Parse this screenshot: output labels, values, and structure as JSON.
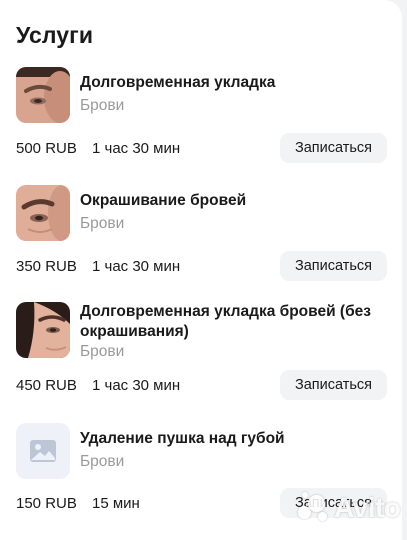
{
  "section": {
    "title": "Услуги"
  },
  "services": [
    {
      "name": "Долговременная укладка",
      "category": "Брови",
      "price": "500 RUB",
      "duration": "1 час 30 мин",
      "book_label": "Записаться"
    },
    {
      "name": "Окрашивание бровей",
      "category": "Брови",
      "price": "350 RUB",
      "duration": "1 час 30 мин",
      "book_label": "Записаться"
    },
    {
      "name": "Долговременная укладка бровей (без окрашивания)",
      "category": "Брови",
      "price": "450 RUB",
      "duration": "1 час 30 мин",
      "book_label": "Записаться"
    },
    {
      "name": "Удаление пушка над губой",
      "category": "Брови",
      "price": "150 RUB",
      "duration": "15 мин",
      "book_label": "Записаться"
    }
  ],
  "watermark": {
    "text": "Avito"
  },
  "colors": {
    "background": "#f2f3f5",
    "card": "#ffffff",
    "muted_text": "#9a9a9a",
    "button_bg": "#f2f3f5",
    "placeholder_bg": "#eef2f8"
  }
}
